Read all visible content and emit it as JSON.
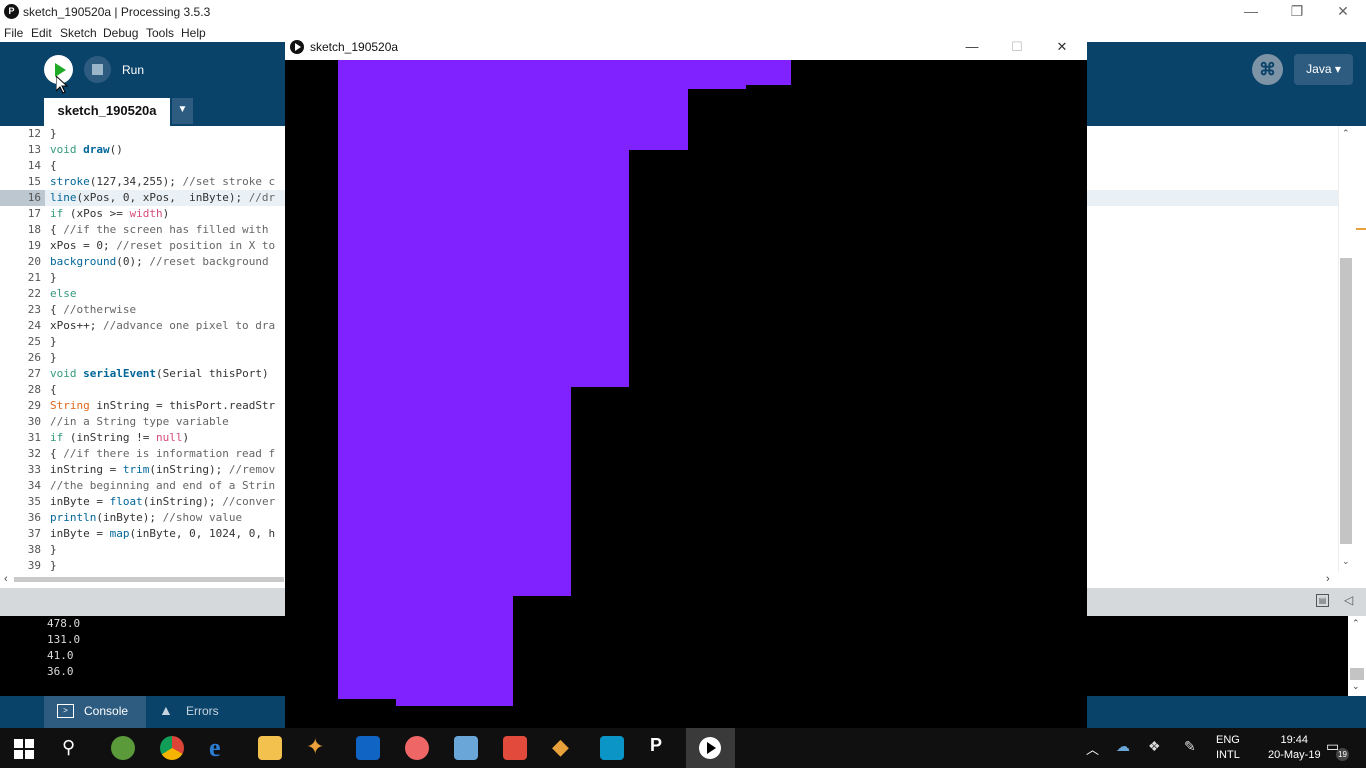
{
  "window": {
    "title": "sketch_190520a | Processing 3.5.3"
  },
  "menu": {
    "items": [
      "File",
      "Edit",
      "Sketch",
      "Debug",
      "Tools",
      "Help"
    ]
  },
  "toolbar": {
    "run_label": "Run",
    "mode": "Java ▾"
  },
  "tab": {
    "name": "sketch_190520a"
  },
  "editor": {
    "lines": [
      {
        "n": "12",
        "t": "}"
      },
      {
        "n": "13",
        "t": "void draw()"
      },
      {
        "n": "14",
        "t": "{"
      },
      {
        "n": "15",
        "t": "stroke(127,34,255); //set stroke c"
      },
      {
        "n": "16",
        "t": "line(xPos, 0, xPos,  inByte); //dr"
      },
      {
        "n": "17",
        "t": "if (xPos >= width)"
      },
      {
        "n": "18",
        "t": "{ //if the screen has filled with"
      },
      {
        "n": "19",
        "t": "xPos = 0; //reset position in X to"
      },
      {
        "n": "20",
        "t": "background(0); //reset background"
      },
      {
        "n": "21",
        "t": "}"
      },
      {
        "n": "22",
        "t": "else"
      },
      {
        "n": "23",
        "t": "{ //otherwise"
      },
      {
        "n": "24",
        "t": "xPos++; //advance one pixel to dra"
      },
      {
        "n": "25",
        "t": "}"
      },
      {
        "n": "26",
        "t": "}"
      },
      {
        "n": "27",
        "t": "void serialEvent(Serial thisPort)"
      },
      {
        "n": "28",
        "t": "{"
      },
      {
        "n": "29",
        "t": "String inString = thisPort.readStr"
      },
      {
        "n": "30",
        "t": "//in a String type variable"
      },
      {
        "n": "31",
        "t": "if (inString != null)"
      },
      {
        "n": "32",
        "t": "{ //if there is information read f"
      },
      {
        "n": "33",
        "t": "inString = trim(inString); //remov"
      },
      {
        "n": "34",
        "t": "//the beginning and end of a Strin"
      },
      {
        "n": "35",
        "t": "inByte = float(inString); //conver"
      },
      {
        "n": "36",
        "t": "println(inByte); //show value"
      },
      {
        "n": "37",
        "t": "inByte = map(inByte, 0, 1024, 0, h"
      },
      {
        "n": "38",
        "t": "}"
      },
      {
        "n": "39",
        "t": "}"
      }
    ]
  },
  "console": {
    "lines": [
      "478.0",
      "131.0",
      "41.0",
      "36.0"
    ]
  },
  "footer": {
    "console_tab": "Console",
    "errors_tab": "Errors"
  },
  "sketch_window": {
    "title": "sketch_190520a",
    "stroke_color": "#7f22ff"
  },
  "taskbar": {
    "lang_top": "ENG",
    "lang_bottom": "INTL",
    "time": "19:44",
    "date": "20-May-19",
    "notifications": "19"
  },
  "colors": {
    "ide_blue": "#0a4369",
    "run_green": "#1faa27",
    "sketch_purple": "#7f22ff"
  }
}
